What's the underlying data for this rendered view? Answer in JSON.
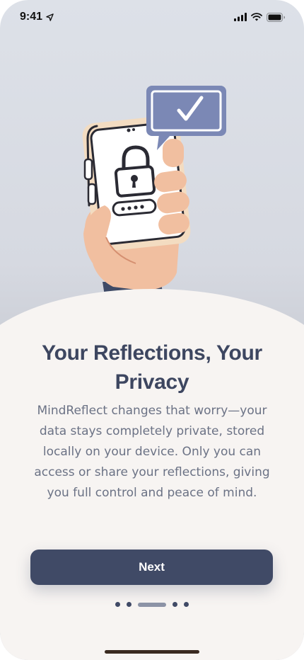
{
  "status_bar": {
    "time": "9:41",
    "icons": [
      "location-arrow-icon",
      "cellular-signal-icon",
      "wifi-icon",
      "battery-icon"
    ]
  },
  "illustration": {
    "icons": [
      "phone-illustration",
      "padlock-icon",
      "password-field-icon",
      "checkmark-bubble-icon",
      "hand-illustration"
    ]
  },
  "onboarding": {
    "title": "Your Reflections, Your Privacy",
    "body": "MindReflect changes that worry—your data stays completely private, stored locally on your device. Only you can access or share your reflections, giving you full control and peace of mind.",
    "next_label": "Next"
  },
  "pager": {
    "total": 5,
    "active_index": 2
  },
  "colors": {
    "primary": "#404a66",
    "title": "#3d4660",
    "body": "#6b7285",
    "sheet_bg": "#f7f4f2",
    "bubble": "#7b88b5"
  }
}
